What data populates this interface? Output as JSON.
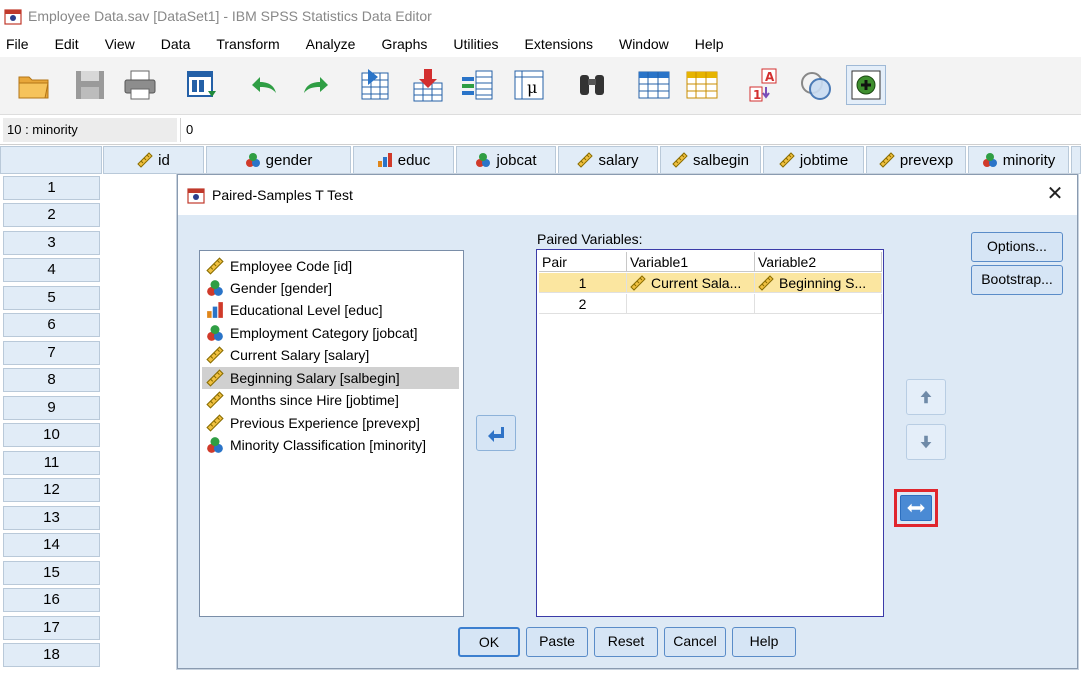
{
  "window": {
    "title": "Employee Data.sav [DataSet1] - IBM SPSS Statistics Data Editor"
  },
  "menu": [
    "File",
    "Edit",
    "View",
    "Data",
    "Transform",
    "Analyze",
    "Graphs",
    "Utilities",
    "Extensions",
    "Window",
    "Help"
  ],
  "toolbar": {
    "icons": [
      "open-folder-icon",
      "save-icon",
      "print-icon",
      "dialog-recall-icon",
      "undo-icon",
      "redo-icon",
      "goto-case-icon",
      "goto-variable-icon",
      "variables-icon",
      "custom-tables-icon",
      "find-icon",
      "insert-cases-icon",
      "insert-variable-icon",
      "value-labels-icon",
      "use-sets-icon",
      "spelling-icon"
    ]
  },
  "cell_editor": {
    "ref": "10 : minority",
    "value": "0"
  },
  "grid": {
    "columns": [
      {
        "name": "id",
        "icon": "scale-ruler-icon"
      },
      {
        "name": "gender",
        "icon": "nominal-icon"
      },
      {
        "name": "educ",
        "icon": "ordinal-icon"
      },
      {
        "name": "jobcat",
        "icon": "nominal-icon"
      },
      {
        "name": "salary",
        "icon": "scale-ruler-icon"
      },
      {
        "name": "salbegin",
        "icon": "scale-ruler-icon"
      },
      {
        "name": "jobtime",
        "icon": "scale-ruler-icon"
      },
      {
        "name": "prevexp",
        "icon": "scale-ruler-icon"
      },
      {
        "name": "minority",
        "icon": "nominal-icon"
      }
    ],
    "rows": [
      "1",
      "2",
      "3",
      "4",
      "5",
      "6",
      "7",
      "8",
      "9",
      "10",
      "11",
      "12",
      "13",
      "14",
      "15",
      "16",
      "17",
      "18"
    ]
  },
  "dialog": {
    "title": "Paired-Samples T Test",
    "variables": [
      {
        "label": "Employee Code [id]",
        "icon": "scale-ruler-icon"
      },
      {
        "label": "Gender [gender]",
        "icon": "nominal-icon"
      },
      {
        "label": "Educational Level [educ]",
        "icon": "ordinal-icon"
      },
      {
        "label": "Employment Category [jobcat]",
        "icon": "nominal-icon"
      },
      {
        "label": "Current Salary [salary]",
        "icon": "scale-ruler-icon"
      },
      {
        "label": "Beginning Salary [salbegin]",
        "icon": "scale-ruler-icon",
        "selected": true
      },
      {
        "label": "Months since Hire [jobtime]",
        "icon": "scale-ruler-icon"
      },
      {
        "label": "Previous Experience [prevexp]",
        "icon": "scale-ruler-icon"
      },
      {
        "label": "Minority Classification [minority]",
        "icon": "nominal-icon"
      }
    ],
    "paired_label": "Paired Variables:",
    "paired_headers": [
      "Pair",
      "Variable1",
      "Variable2"
    ],
    "pairs": [
      {
        "pair": "1",
        "var1": "Current Sala...",
        "var2": "Beginning S..."
      },
      {
        "pair": "2",
        "var1": "",
        "var2": ""
      }
    ],
    "side_buttons": [
      "Options...",
      "Bootstrap..."
    ],
    "bottom_buttons": [
      "OK",
      "Paste",
      "Reset",
      "Cancel",
      "Help"
    ]
  }
}
